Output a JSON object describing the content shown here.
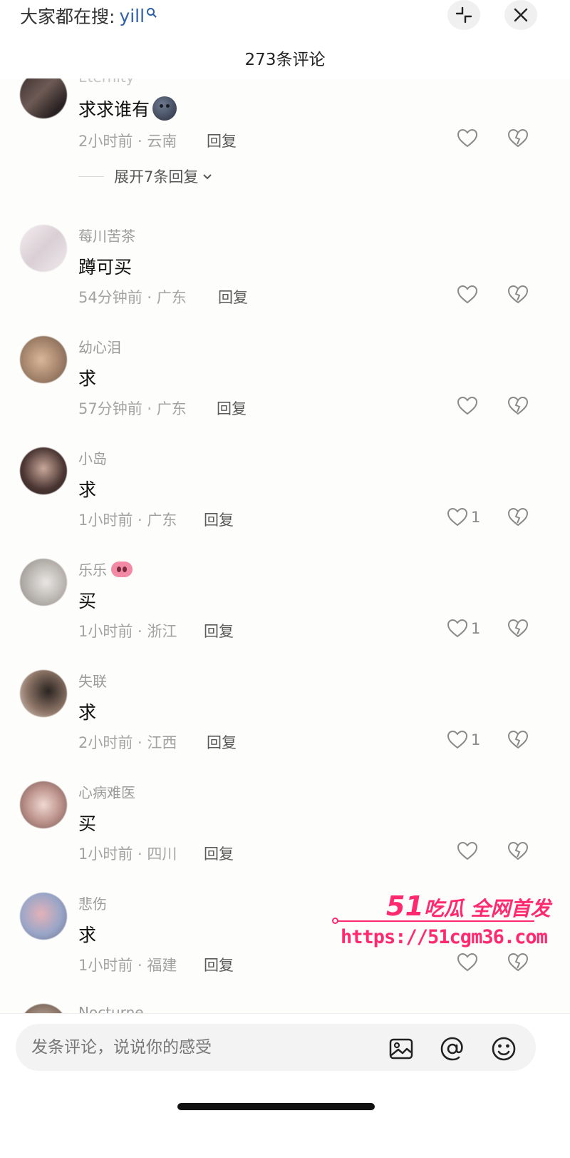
{
  "header": {
    "search_prefix": "大家都在搜:",
    "search_keyword": "yill",
    "title": "273条评论",
    "collapse_icon": "collapse-icon",
    "close_icon": "close-icon"
  },
  "comments": [
    {
      "username": "Eternity",
      "text": "求求谁有",
      "emoji": "dark-face-emoji",
      "meta": "2小时前 · 云南",
      "reply": "回复",
      "likes": "",
      "expand": "展开7条回复"
    },
    {
      "username": "莓川苦茶",
      "text": "蹲可买",
      "meta": "54分钟前 · 广东",
      "reply": "回复",
      "likes": ""
    },
    {
      "username": "幼心泪",
      "text": "求",
      "meta": "57分钟前 · 广东",
      "reply": "回复",
      "likes": ""
    },
    {
      "username": "小岛",
      "text": "求",
      "meta": "1小时前 · 广东",
      "reply": "回复",
      "likes": "1"
    },
    {
      "username": "乐乐",
      "username_emoji": "pig-emoji",
      "text": "买",
      "meta": "1小时前 · 浙江",
      "reply": "回复",
      "likes": "1"
    },
    {
      "username": "失联",
      "text": "求",
      "meta": "2小时前 · 江西",
      "reply": "回复",
      "likes": "1"
    },
    {
      "username": "心病难医",
      "text": "买",
      "meta": "1小时前 · 四川",
      "reply": "回复",
      "likes": ""
    },
    {
      "username": "悲伤",
      "text": "求",
      "meta": "1小时前 · 福建",
      "reply": "回复",
      "likes": ""
    },
    {
      "username": "Nocturne"
    }
  ],
  "watermark": {
    "brand_num": "51",
    "brand_text": "吃瓜 全网首发",
    "url": "https://51cgm36.com"
  },
  "composer": {
    "placeholder": "发条评论，说说你的感受",
    "icons": [
      "image-icon",
      "at-icon",
      "emoji-icon"
    ]
  },
  "colors": {
    "accent_link": "#2f5fa8",
    "watermark": "#ff2a6d"
  }
}
